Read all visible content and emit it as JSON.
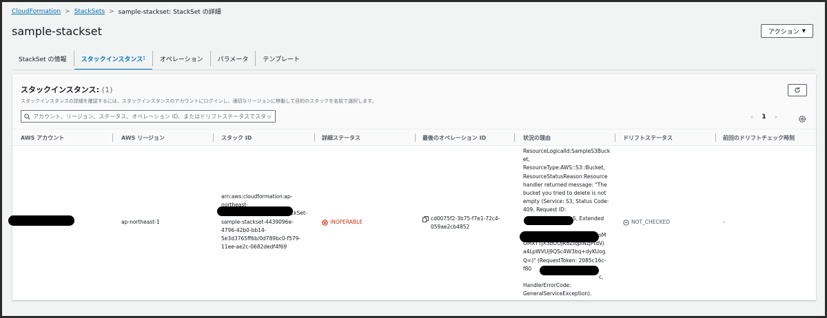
{
  "breadcrumb": {
    "items": [
      "CloudFormation",
      "StackSets"
    ],
    "current": "sample-stackset: StackSet の詳細",
    "separator": ">"
  },
  "page_title": "sample-stackset",
  "actions_label": "アクション",
  "tabs": [
    {
      "label": "StackSet の情報"
    },
    {
      "label": "スタックインスタンス"
    },
    {
      "label": "オペレーション"
    },
    {
      "label": "パラメータ"
    },
    {
      "label": "テンプレート"
    }
  ],
  "panel": {
    "title": "スタックインスタンス",
    "count": "(1)",
    "description": "スタックインスタンスの詳細を確認するには、スタックインスタンスのアカウントにログインし、適切なリージョンに移動して目的のスタックを名前で選択します。",
    "search_placeholder": "アカウント、リージョン、ステータス、オペレーション ID、またはドリフトステータスでスタッ",
    "page_number": "1"
  },
  "table": {
    "headers": [
      "AWS アカウント",
      "AWS リージョン",
      "スタック ID",
      "詳細ステータス",
      "最後のオペレーション ID",
      "状況の理由",
      "ドリフトステータス",
      "前回のドリフトチェック時刻"
    ],
    "row": {
      "account": "",
      "region": "ap-northeast-1",
      "stack_id": [
        "arn:aws:cloudformation:ap-",
        "northeast-",
        "k/StackSet-",
        "sample-stackset-4439096e-",
        "4796-42b0-bb14-",
        "5e3d3765ff6b/0d789bc0-f579-",
        "11ee-ae2c-0682dedf4f69"
      ],
      "detail_status": "INOPERABLE",
      "operation_id": [
        "cd0075f2-3b75-f7e1-72c4-",
        "059ae2cb4852"
      ],
      "status_reason": [
        "ResourceLogicalId:SampleS3Buck",
        "et,",
        "ResourceType:AWS::S3::Bucket,",
        "ResourceStatusReason:Resource",
        "handler returned message: \"The",
        "bucket you tried to delete is not",
        "empty (Service: S3, Status Code:",
        "409, Request ID:",
        "5, Extended",
        "",
        "sM",
        "OMXTTJX3bOOJR8ZlqpINzjPtdVj",
        "a4LpWVUj9QSc4W3bq+dyKUog",
        "Q=)\" (RequestToken: 2085c16c-",
        "f80",
        "c,",
        "HandlerErrorCode:",
        "GeneralServiceException)."
      ],
      "drift_status": "NOT_CHECKED",
      "last_drift_check": "-"
    }
  },
  "colors": {
    "link": "#0073bb",
    "error": "#d13212",
    "background": "#f2f3f3"
  }
}
